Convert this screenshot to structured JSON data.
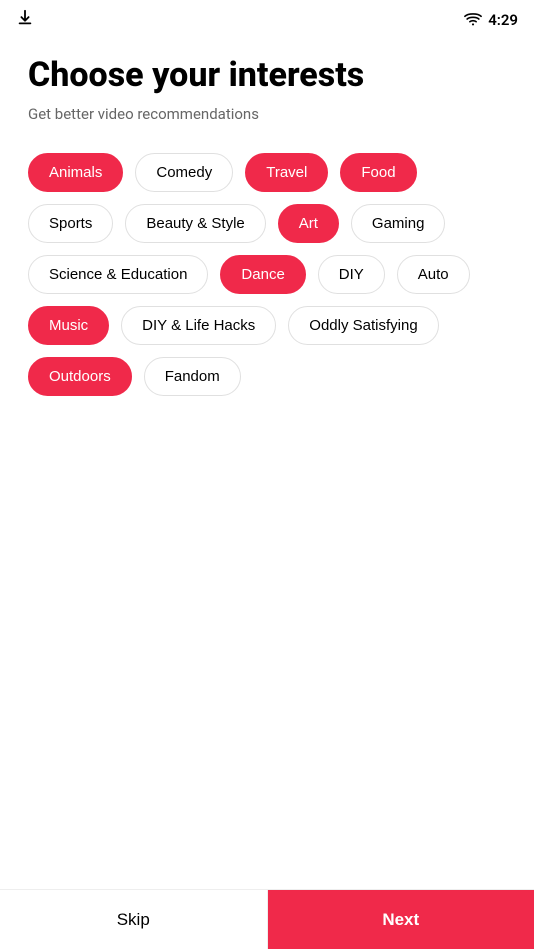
{
  "statusBar": {
    "time": "4:29"
  },
  "header": {
    "title": "Choose your interests",
    "subtitle": "Get better video recommendations"
  },
  "tags": [
    {
      "id": "animals",
      "label": "Animals",
      "selected": true
    },
    {
      "id": "comedy",
      "label": "Comedy",
      "selected": false
    },
    {
      "id": "travel",
      "label": "Travel",
      "selected": true
    },
    {
      "id": "food",
      "label": "Food",
      "selected": true
    },
    {
      "id": "sports",
      "label": "Sports",
      "selected": false
    },
    {
      "id": "beauty-style",
      "label": "Beauty & Style",
      "selected": false
    },
    {
      "id": "art",
      "label": "Art",
      "selected": true
    },
    {
      "id": "gaming",
      "label": "Gaming",
      "selected": false
    },
    {
      "id": "science-education",
      "label": "Science & Education",
      "selected": false
    },
    {
      "id": "dance",
      "label": "Dance",
      "selected": true
    },
    {
      "id": "diy",
      "label": "DIY",
      "selected": false
    },
    {
      "id": "auto",
      "label": "Auto",
      "selected": false
    },
    {
      "id": "music",
      "label": "Music",
      "selected": true
    },
    {
      "id": "diy-life-hacks",
      "label": "DIY & Life Hacks",
      "selected": false
    },
    {
      "id": "oddly-satisfying",
      "label": "Oddly Satisfying",
      "selected": false
    },
    {
      "id": "outdoors",
      "label": "Outdoors",
      "selected": true
    },
    {
      "id": "fandom",
      "label": "Fandom",
      "selected": false
    }
  ],
  "buttons": {
    "skip": "Skip",
    "next": "Next"
  }
}
